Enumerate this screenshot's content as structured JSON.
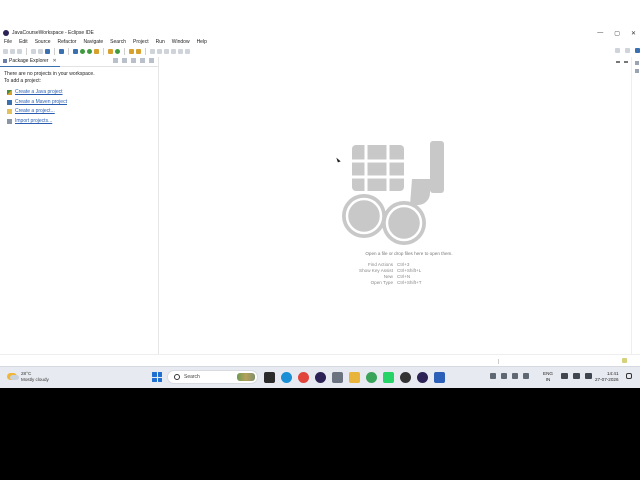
{
  "window": {
    "title": "JavaCourseWorkspace - Eclipse IDE",
    "minimize": "—",
    "maximize": "▢",
    "close": "✕"
  },
  "menu": [
    "File",
    "Edit",
    "Source",
    "Refactor",
    "Navigate",
    "Search",
    "Project",
    "Run",
    "Window",
    "Help"
  ],
  "package_explorer": {
    "tab_label": "Package Explorer",
    "close": "✕",
    "message_line1": "There are no projects in your workspace.",
    "message_line2": "To add a project:",
    "links": [
      {
        "label": "Create a Java project",
        "icon": "java-project-icon"
      },
      {
        "label": "Create a Maven project",
        "icon": "maven-project-icon"
      },
      {
        "label": "Create a project...",
        "icon": "new-project-icon"
      },
      {
        "label": "Import projects...",
        "icon": "import-projects-icon"
      }
    ]
  },
  "editor": {
    "hint": "Open a file or drop files here to open them.",
    "shortcuts": [
      {
        "name": "Find Actions",
        "keys": "Ctrl+3"
      },
      {
        "name": "Show Key Assist",
        "keys": "Ctrl+Shift+L"
      },
      {
        "name": "New",
        "keys": "Ctrl+N"
      },
      {
        "name": "Open Type",
        "keys": "Ctrl+Shift+T"
      }
    ]
  },
  "taskbar": {
    "weather_temp": "28°C",
    "weather_desc": "Mostly cloudy",
    "search_label": "Search",
    "lang_line1": "ENG",
    "lang_line2": "IN",
    "time": "14:41",
    "date": "27-07-2026",
    "apps": [
      {
        "name": "file-manager-icon",
        "color": "#2b2b2b"
      },
      {
        "name": "edge-icon",
        "color": "#1a8fd6"
      },
      {
        "name": "chrome-icon",
        "color": "#e0443b"
      },
      {
        "name": "eclipse-taskbar-icon",
        "color": "#2c2255"
      },
      {
        "name": "camera-icon",
        "color": "#6b7380"
      },
      {
        "name": "folder-icon",
        "color": "#e8b43a"
      },
      {
        "name": "chrome-profile-icon",
        "color": "#3aa35a"
      },
      {
        "name": "whatsapp-icon",
        "color": "#25d366"
      },
      {
        "name": "chatgpt-icon",
        "color": "#333333"
      },
      {
        "name": "eclipse-active-icon",
        "color": "#2c2255"
      },
      {
        "name": "word-icon",
        "color": "#2b5fb8"
      }
    ]
  },
  "colors": {
    "accent": "#3a6fb0",
    "link": "#2a5db0",
    "logo_gray": "#c8c8c8"
  }
}
